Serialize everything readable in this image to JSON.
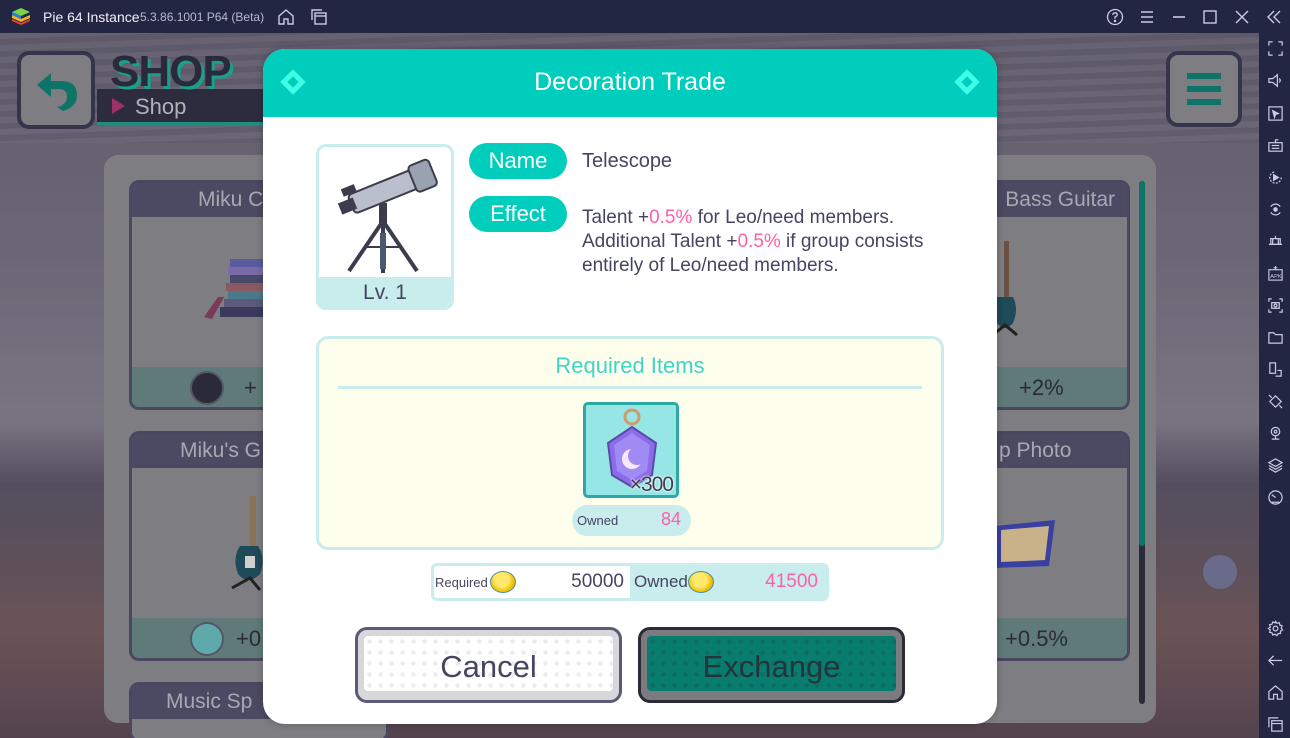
{
  "emulator": {
    "app_title": "Pie 64 Instance",
    "version": "5.3.86.1001 P64 (Beta)",
    "titlebar_icons": [
      "home-icon",
      "multi-instance-icon",
      "help-icon",
      "menu-icon",
      "minimize-icon",
      "maximize-icon",
      "close-icon",
      "collapse-sidebar-icon"
    ],
    "sidebar_icons": [
      "fullscreen-icon",
      "volume-icon",
      "pointer-icon",
      "keyboard-icon",
      "macro-record-icon",
      "sync-icon",
      "controls-icon",
      "apk-install-icon",
      "screenshot-icon",
      "folder-icon",
      "multi-screen-icon",
      "rotate-icon",
      "location-icon",
      "layers-icon",
      "performance-icon",
      "settings-icon",
      "back-icon",
      "home-icon",
      "recent-apps-icon"
    ]
  },
  "shop": {
    "heading": "SHOP",
    "breadcrumb": "Shop",
    "cards": [
      {
        "title": "Miku C",
        "bonus": "+"
      },
      {
        "title": "Bass Guitar",
        "bonus": "+2%"
      },
      {
        "title": "Miku's G",
        "bonus": "+0"
      },
      {
        "title": "p Photo",
        "bonus": "+0.5%"
      },
      {
        "title": "Music Sp"
      }
    ]
  },
  "modal": {
    "title": "Decoration Trade",
    "item": {
      "level": "Lv. 1",
      "name_label": "Name",
      "name": "Telescope",
      "effect_label": "Effect",
      "effect_parts": {
        "p1": "Talent +",
        "v1": "0.5%",
        "p2": " for Leo/need members. Additional Talent +",
        "v2": "0.5%",
        "p3": " if group consists entirely of Leo/need members."
      }
    },
    "required_items": {
      "title": "Required Items",
      "items": [
        {
          "icon": "moon-charm-icon",
          "quantity": "×300",
          "owned_label": "Owned",
          "owned": "84"
        }
      ]
    },
    "coins": {
      "required_label": "Required",
      "required": "50000",
      "owned_label": "Owned",
      "owned": "41500"
    },
    "buttons": {
      "cancel": "Cancel",
      "exchange": "Exchange"
    }
  },
  "colors": {
    "accent": "#00cdbc",
    "highlight": "#ff5fa8",
    "text": "#454561"
  }
}
